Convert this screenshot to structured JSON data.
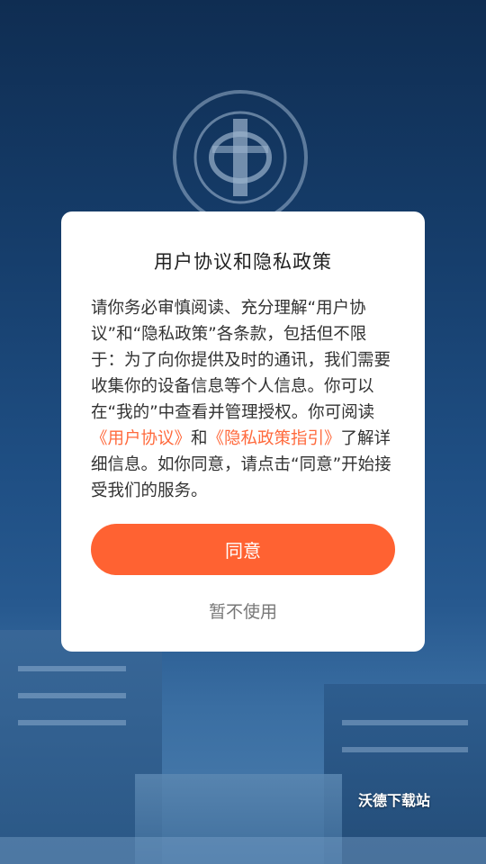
{
  "background": {
    "emblem_icon": "university-emblem"
  },
  "dialog": {
    "title": "用户协议和隐私政策",
    "body_parts": [
      "请你务必审慎阅读、充分理解“用户协议”和“隐私政策”各条款，包括但不限于：为了向你提供及时的通讯，我们需要收集你的设备信息等个人信息。你可以在“我的”中查看并管理授权。你可阅读",
      "《用户协议》",
      "和",
      "《隐私政策指引》",
      "了解详细信息。如你同意，请点击“同意”开始接受我们的服务。"
    ],
    "agree_label": "同意",
    "decline_label": "暂不使用"
  },
  "colors": {
    "accent": "#ff6232",
    "link": "#ff6a3d",
    "background_top": "#0f2d52"
  },
  "watermark": "沃德下载站"
}
